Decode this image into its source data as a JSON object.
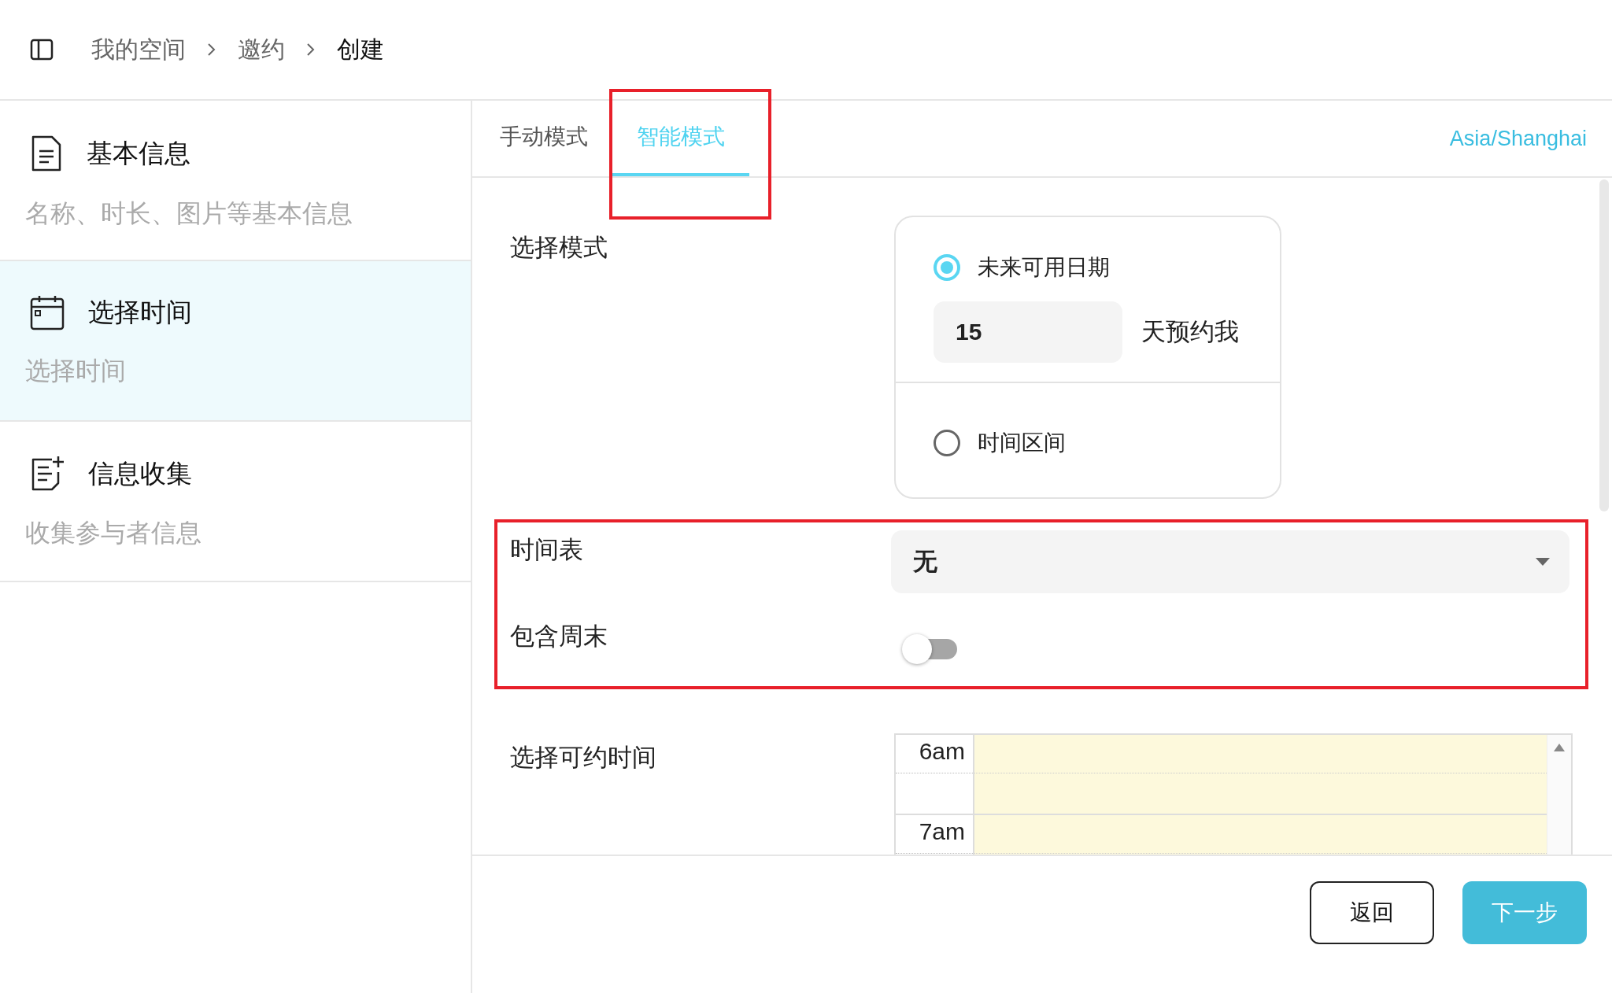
{
  "breadcrumb": [
    {
      "label": "我的空间",
      "current": false
    },
    {
      "label": "邀约",
      "current": false
    },
    {
      "label": "创建",
      "current": true
    }
  ],
  "steps": [
    {
      "kind": "document",
      "title": "基本信息",
      "description": "名称、时长、图片等基本信息",
      "selected": false
    },
    {
      "kind": "calendar",
      "title": "选择时间",
      "description": "选择时间",
      "selected": true
    },
    {
      "kind": "form",
      "title": "信息收集",
      "description": "收集参与者信息",
      "selected": false
    }
  ],
  "tabs": [
    {
      "label": "手动模式",
      "selected": false,
      "highlighted": false
    },
    {
      "label": "智能模式",
      "selected": true,
      "highlighted": true
    }
  ],
  "timezone": "Asia/Shanghai",
  "mode": {
    "label": "选择模式",
    "options": [
      {
        "label": "未来可用日期",
        "selected": true,
        "days": "15",
        "suffix": "天预约我"
      },
      {
        "label": "时间区间",
        "selected": false
      }
    ]
  },
  "settings_group": {
    "highlighted": true,
    "schedule": {
      "label": "时间表",
      "value": "无"
    },
    "weekends": {
      "label": "包含周末",
      "on": false
    }
  },
  "availability": {
    "label": "选择可约时间",
    "hours": [
      "6am",
      "7am"
    ]
  },
  "buttons": {
    "back": "返回",
    "next": "下一步"
  }
}
